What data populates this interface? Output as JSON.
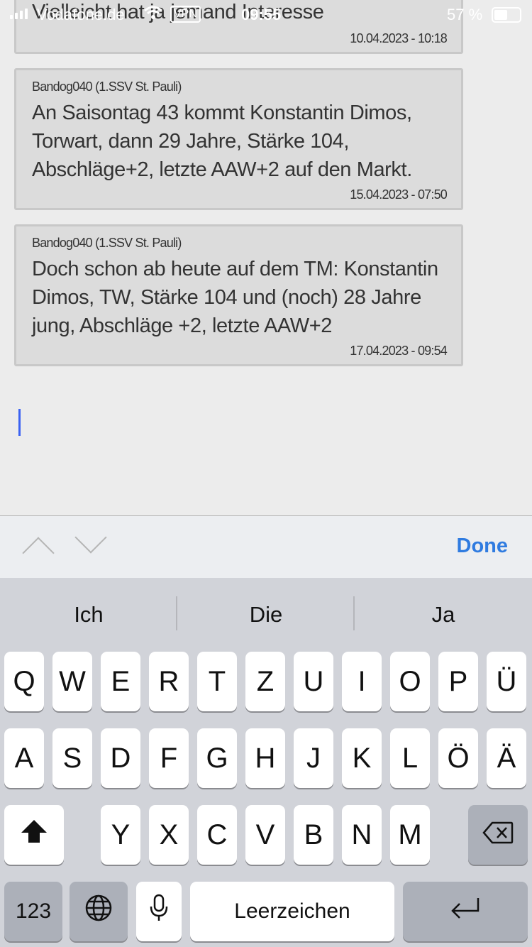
{
  "status_bar": {
    "carrier": "Vodafone.de",
    "vpn": "VPN",
    "time": "09:55",
    "battery": "57 %"
  },
  "messages": [
    {
      "author": "",
      "text": "Vielleicht hat ja jemand Interesse",
      "date": "10.04.2023 - 10:18"
    },
    {
      "author": "Bandog040 (1.SSV St. Pauli)",
      "text": "An Saisontag 43 kommt Konstantin Dimos, Torwart, dann 29 Jahre, Stärke 104, Abschläge+2, letzte AAW+2 auf den Markt.",
      "date": "15.04.2023 - 07:50"
    },
    {
      "author": "Bandog040 (1.SSV St. Pauli)",
      "text": "Doch schon ab heute auf dem TM: Konstantin Dimos, TW, Stärke 104 und (noch) 28 Jahre jung, Abschläge +2, letzte AAW+2",
      "date": "17.04.2023 - 09:54"
    }
  ],
  "toolbar": {
    "done_label": "Done"
  },
  "keyboard": {
    "predictions": [
      "Ich",
      "Die",
      "Ja"
    ],
    "row1": [
      "Q",
      "W",
      "E",
      "R",
      "T",
      "Z",
      "U",
      "I",
      "O",
      "P",
      "Ü"
    ],
    "row2": [
      "A",
      "S",
      "D",
      "F",
      "G",
      "H",
      "J",
      "K",
      "L",
      "Ö",
      "Ä"
    ],
    "row3": [
      "Y",
      "X",
      "C",
      "V",
      "B",
      "N",
      "M"
    ],
    "numbers_label": "123",
    "space_label": "Leerzeichen",
    "icons": {
      "shift": "shift-icon",
      "backspace": "backspace-icon",
      "globe": "globe-icon",
      "mic": "microphone-icon",
      "return": "return-icon"
    }
  }
}
